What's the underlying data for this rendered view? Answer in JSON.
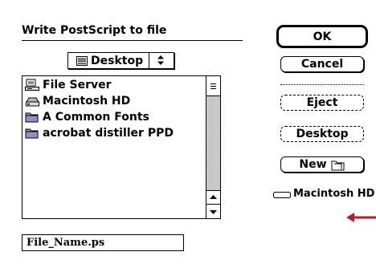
{
  "dialog": {
    "title": "Write PostScript to file"
  },
  "folder_popup": {
    "selected": "Desktop",
    "icon": "desktop-icon"
  },
  "file_list": {
    "items": [
      {
        "label": "File Server",
        "icon": "file-server-icon"
      },
      {
        "label": "Macintosh HD",
        "icon": "hard-disk-icon"
      },
      {
        "label": "A Common Fonts",
        "icon": "folder-icon"
      },
      {
        "label": "acrobat distiller PPD",
        "icon": "folder-icon"
      }
    ]
  },
  "filename_field": {
    "value": "File_Name.ps"
  },
  "buttons": {
    "ok": "OK",
    "cancel": "Cancel",
    "eject": "Eject",
    "desktop": "Desktop",
    "new": "New"
  },
  "volume": {
    "label": "Macintosh HD",
    "icon": "hard-disk-icon"
  },
  "annotation": {
    "arrow_color": "#b0202a",
    "icon": "left-arrow-icon"
  }
}
